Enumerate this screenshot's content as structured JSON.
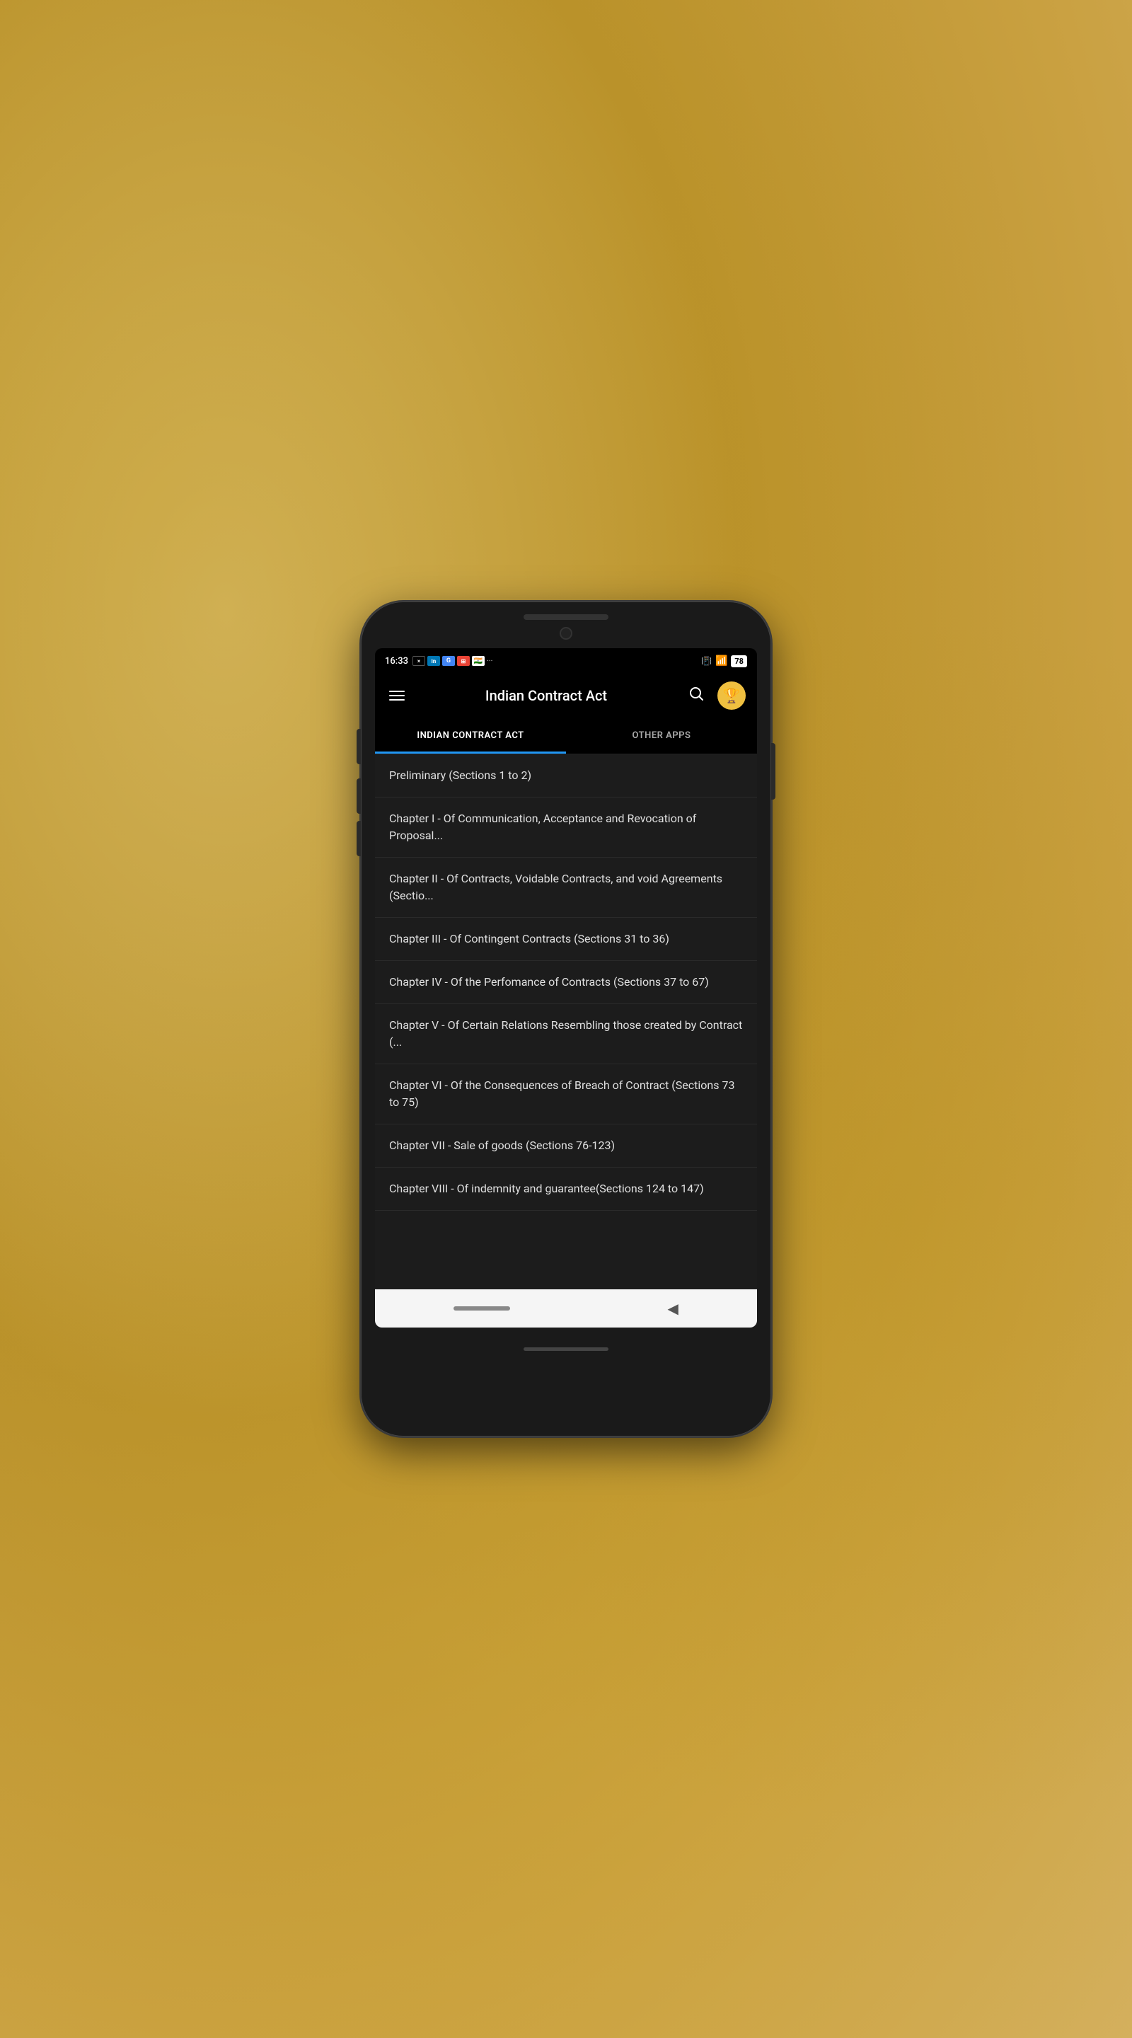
{
  "status": {
    "time": "16:33",
    "battery": "78",
    "app_icons": [
      "×",
      "in",
      "G",
      "⊞",
      "🇮🇳",
      "···"
    ]
  },
  "appbar": {
    "title": "Indian Contract Act",
    "avatar_emoji": "🏆"
  },
  "tabs": [
    {
      "id": "main",
      "label": "INDIAN CONTRACT ACT",
      "active": true
    },
    {
      "id": "other",
      "label": "OTHER APPS",
      "active": false
    }
  ],
  "list_items": [
    {
      "id": 1,
      "text": "Preliminary (Sections 1 to 2)"
    },
    {
      "id": 2,
      "text": "Chapter I - Of Communication, Acceptance and Revocation of Proposal..."
    },
    {
      "id": 3,
      "text": "Chapter II - Of Contracts, Voidable Contracts, and void Agreements (Sectio..."
    },
    {
      "id": 4,
      "text": "Chapter III - Of Contingent Contracts (Sections 31 to 36)"
    },
    {
      "id": 5,
      "text": "Chapter IV - Of the Perfomance of Contracts (Sections 37 to 67)"
    },
    {
      "id": 6,
      "text": "Chapter V - Of Certain Relations Resembling those created by Contract (..."
    },
    {
      "id": 7,
      "text": "Chapter VI - Of the Consequences of Breach of Contract (Sections 73 to 75)"
    },
    {
      "id": 8,
      "text": "Chapter VII - Sale of goods (Sections 76-123)"
    },
    {
      "id": 9,
      "text": "Chapter VIII - Of indemnity and guarantee(Sections 124 to 147)"
    }
  ]
}
